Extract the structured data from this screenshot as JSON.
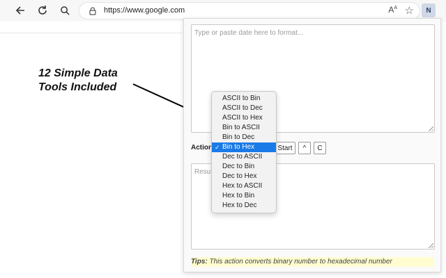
{
  "browser": {
    "url": "https://www.google.com",
    "icons": {
      "back": "back-arrow-icon",
      "reload": "reload-icon",
      "search": "search-icon",
      "lock": "lock-icon",
      "read_aloud": "read-aloud-icon",
      "favorite": "star-icon"
    },
    "read_aloud_glyph": "A",
    "profile_initial": "N"
  },
  "annotation": {
    "line1": "12 Simple Data",
    "line2": "Tools Included"
  },
  "popup": {
    "input_placeholder": "Type or paste date here to format...",
    "action_label": "Action",
    "start_label": "Start",
    "up_label": "^",
    "clear_label": "C",
    "result_placeholder": "Result",
    "tips_label": "Tips:",
    "tips_text": "This action converts binary number to hexadecimal number"
  },
  "dropdown": {
    "options": [
      "ASCII to Bin",
      "ASCII to Dec",
      "ASCII to Hex",
      "Bin to ASCII",
      "Bin to Dec",
      "Bin to Hex",
      "Dec to ASCII",
      "Dec to Bin",
      "Dec to Hex",
      "Hex to ASCII",
      "Hex to Bin",
      "Hex to Dec"
    ],
    "selected": "Bin to Hex",
    "check_glyph": "✓"
  },
  "colors": {
    "selected_bg": "#1a7ae8",
    "tips_bg": "#fffdd0"
  }
}
